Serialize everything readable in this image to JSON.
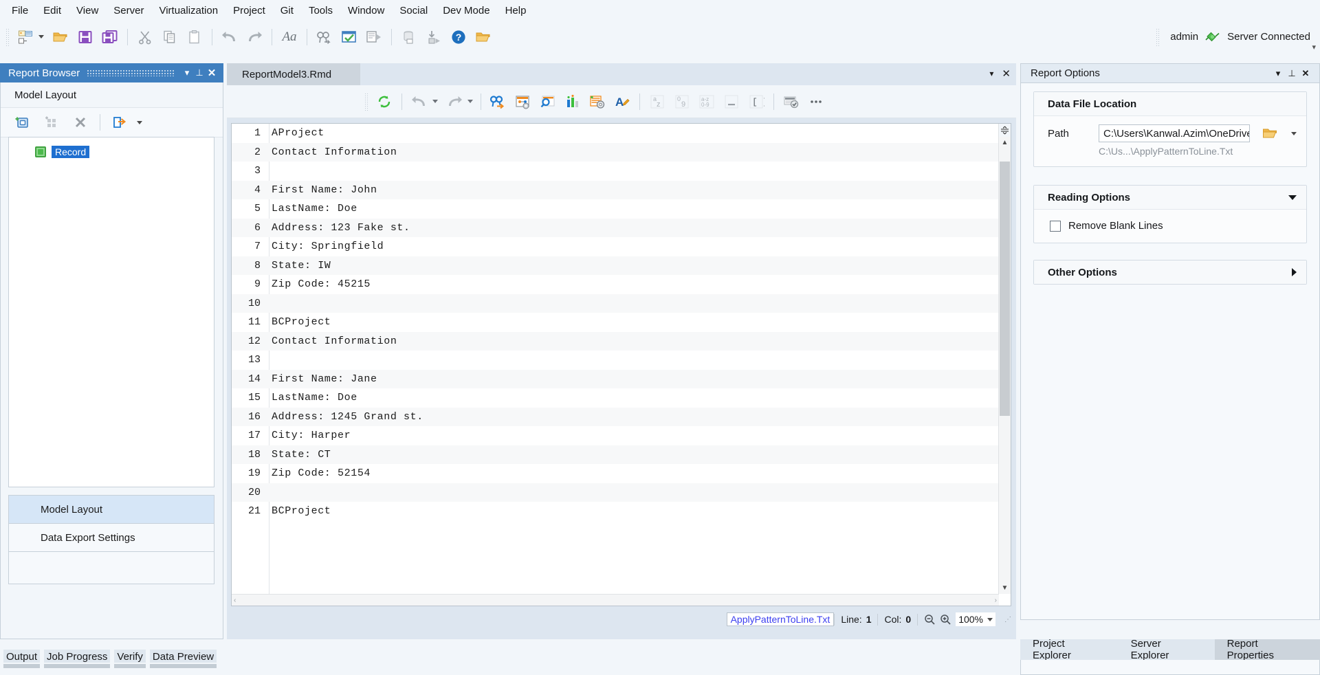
{
  "menu": {
    "items": [
      {
        "label": "File"
      },
      {
        "label": "Edit"
      },
      {
        "label": "View"
      },
      {
        "label": "Server"
      },
      {
        "label": "Virtualization"
      },
      {
        "label": "Project"
      },
      {
        "label": "Git"
      },
      {
        "label": "Tools"
      },
      {
        "label": "Window"
      },
      {
        "label": "Social"
      },
      {
        "label": "Dev Mode"
      },
      {
        "label": "Help"
      }
    ]
  },
  "toolbar": {
    "icons": [
      "new-report-icon",
      "open-folder-icon",
      "save-icon",
      "save-all-icon",
      "cut-icon",
      "copy-icon",
      "paste-icon",
      "undo-icon",
      "redo-icon",
      "font-icon",
      "find-next-icon",
      "verify-icon",
      "run-step-icon",
      "deploy-icon",
      "run-icon",
      "help-icon",
      "open-project-icon"
    ],
    "user": "admin",
    "connection_icon": "plug-connected-icon",
    "connection_status": "Server Connected"
  },
  "report_browser": {
    "title": "Report Browser",
    "section_label": "Model Layout",
    "tree_toolbar_icons": [
      "add-record-icon",
      "add-group-icon",
      "delete-icon",
      "export-icon"
    ],
    "tree": [
      {
        "label": "Record",
        "icon": "record-node-icon",
        "selected": true
      }
    ],
    "tabs": [
      {
        "label": "Model Layout",
        "selected": true
      },
      {
        "label": "Data Export Settings",
        "selected": false
      }
    ]
  },
  "bottom_tabs": [
    {
      "label": "Output"
    },
    {
      "label": "Job Progress"
    },
    {
      "label": "Verify"
    },
    {
      "label": "Data Preview"
    }
  ],
  "editor": {
    "tab_label": "ReportModel3.Rmd",
    "toolbar_icons": [
      "refresh-icon",
      "undo-icon",
      "redo-icon",
      "find-icon",
      "pattern-settings-icon",
      "inspect-icon",
      "chart-icon",
      "model-settings-icon",
      "text-format-icon",
      "sort-az-icon",
      "sort-09-icon",
      "sort-az09-icon",
      "underline-icon",
      "brackets-icon",
      "validate-icon",
      "more-icon"
    ],
    "lines": [
      {
        "n": "1",
        "text": "AProject"
      },
      {
        "n": "2",
        "text": "Contact Information"
      },
      {
        "n": "3",
        "text": ""
      },
      {
        "n": "4",
        "text": "First Name: John"
      },
      {
        "n": "5",
        "text": "LastName: Doe"
      },
      {
        "n": "6",
        "text": "Address: 123 Fake st."
      },
      {
        "n": "7",
        "text": "City: Springfield"
      },
      {
        "n": "8",
        "text": "State: IW"
      },
      {
        "n": "9",
        "text": "Zip Code: 45215"
      },
      {
        "n": "10",
        "text": ""
      },
      {
        "n": "11",
        "text": "BCProject"
      },
      {
        "n": "12",
        "text": "Contact Information"
      },
      {
        "n": "13",
        "text": ""
      },
      {
        "n": "14",
        "text": "First Name: Jane"
      },
      {
        "n": "15",
        "text": "LastName: Doe"
      },
      {
        "n": "16",
        "text": "Address: 1245 Grand st."
      },
      {
        "n": "17",
        "text": "City: Harper"
      },
      {
        "n": "18",
        "text": "State: CT"
      },
      {
        "n": "19",
        "text": "Zip Code: 52154"
      },
      {
        "n": "20",
        "text": ""
      },
      {
        "n": "21",
        "text": "BCProject"
      }
    ],
    "status": {
      "filename": "ApplyPatternToLine.Txt",
      "line_label": "Line:",
      "line_value": "1",
      "col_label": "Col:",
      "col_value": "0",
      "zoom_out_icon": "zoom-out-icon",
      "zoom_in_icon": "zoom-in-icon",
      "zoom_value": "100%"
    }
  },
  "report_options": {
    "title": "Report Options",
    "data_file_location": {
      "header": "Data File Location",
      "path_label": "Path",
      "path_value": "C:\\Users\\Kanwal.Azim\\OneDrive - A",
      "path_sub": "C:\\Us...\\ApplyPatternToLine.Txt",
      "browse_icon": "folder-icon",
      "dropdown_icon": "chevron-down-icon"
    },
    "reading_options": {
      "header": "Reading Options",
      "expanded": true,
      "checkbox_label": "Remove Blank Lines",
      "checked": false
    },
    "other_options": {
      "header": "Other Options",
      "expanded": false
    },
    "tabs": [
      {
        "label": "Project Explorer",
        "selected": false
      },
      {
        "label": "Server Explorer",
        "selected": false
      },
      {
        "label": "Report Properties",
        "selected": true
      }
    ]
  },
  "colors": {
    "panel_title_bg": "#3f7fbf",
    "accent_blue": "#1e6fd0",
    "app_bg": "#f2f6fa",
    "status_filename": "#3b3ef0"
  }
}
